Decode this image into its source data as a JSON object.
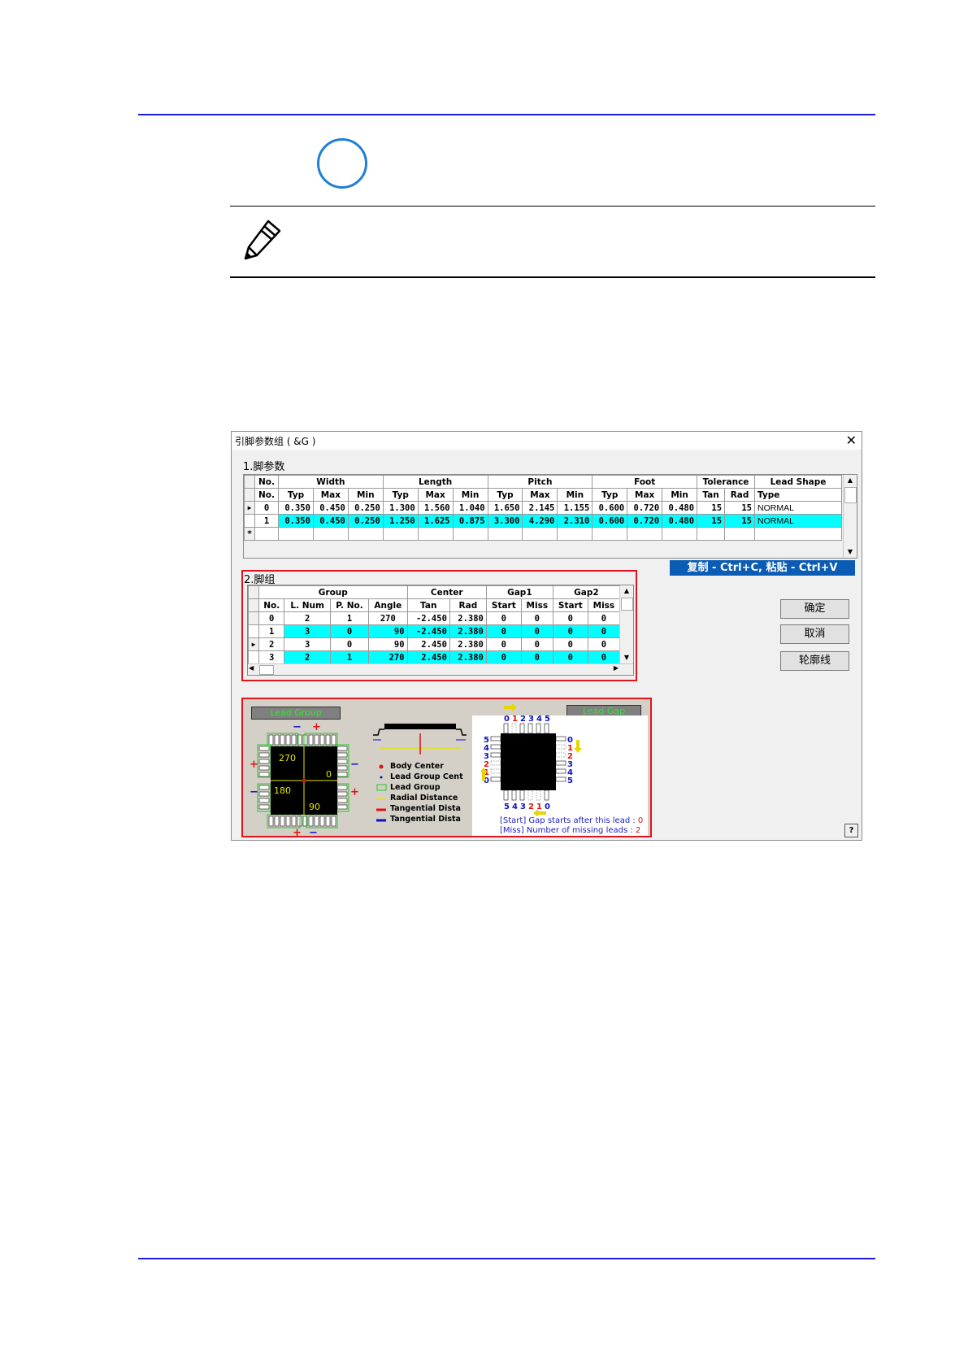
{
  "dialog": {
    "title": "引脚参数组 ( &G )",
    "close": "✕",
    "section1": "1.脚参数",
    "section2": "2.脚组",
    "copy_hint": "复制 - Ctrl+C, 粘贴 - Ctrl+V",
    "buttons": {
      "ok": "确定",
      "cancel": "取消",
      "outline": "轮廓线"
    },
    "help": "?"
  },
  "lead_params": {
    "group_headers": [
      "No.",
      "Width",
      "Length",
      "Pitch",
      "Foot",
      "Tolerance",
      "Lead Shape"
    ],
    "sub_headers": [
      "No.",
      "Typ",
      "Max",
      "Min",
      "Typ",
      "Max",
      "Min",
      "Typ",
      "Max",
      "Min",
      "Typ",
      "Max",
      "Min",
      "Tan",
      "Rad",
      "Type"
    ],
    "rows": [
      [
        "0",
        "0.350",
        "0.450",
        "0.250",
        "1.300",
        "1.560",
        "1.040",
        "1.650",
        "2.145",
        "1.155",
        "0.600",
        "0.720",
        "0.480",
        "15",
        "15",
        "NORMAL"
      ],
      [
        "1",
        "0.350",
        "0.450",
        "0.250",
        "1.250",
        "1.625",
        "0.875",
        "3.300",
        "4.290",
        "2.310",
        "0.600",
        "0.720",
        "0.480",
        "15",
        "15",
        "NORMAL"
      ]
    ],
    "new_row_marker": "*",
    "current_marker": "▶"
  },
  "lead_groups": {
    "group_headers": [
      "Group",
      "Center",
      "Gap1",
      "Gap2"
    ],
    "sub_headers": [
      "No.",
      "L. Num",
      "P. No.",
      "Angle",
      "Tan",
      "Rad",
      "Start",
      "Miss",
      "Start",
      "Miss"
    ],
    "rows": [
      [
        "0",
        "2",
        "1",
        "270",
        "-2.450",
        "2.380",
        "0",
        "0",
        "0",
        "0"
      ],
      [
        "1",
        "3",
        "0",
        "90",
        "-2.450",
        "2.380",
        "0",
        "0",
        "0",
        "0"
      ],
      [
        "2",
        "3",
        "0",
        "90",
        "2.450",
        "2.380",
        "0",
        "0",
        "0",
        "0"
      ],
      [
        "3",
        "2",
        "1",
        "270",
        "2.450",
        "2.380",
        "0",
        "0",
        "0",
        "0"
      ]
    ],
    "current_marker": "▶"
  },
  "diagram": {
    "lead_group_label": "Lead Group",
    "lead_gap_label": "Lead Gap",
    "angles": [
      "270",
      "0",
      "180",
      "90"
    ],
    "signs": {
      "plus": "+",
      "minus": "−"
    },
    "legend": [
      "Body Center",
      "Lead Group Cent",
      "Lead Group",
      "Radial Distance",
      "Tangential Dista",
      "Tangential Dista"
    ],
    "gap_top_numbers": [
      "0",
      "1",
      "2",
      "3",
      "4",
      "5"
    ],
    "gap_right_numbers": [
      "0",
      "1",
      "2",
      "3",
      "4",
      "5"
    ],
    "gap_left_numbers": [
      "5",
      "4",
      "3",
      "2",
      "1",
      "0"
    ],
    "gap_bottom_numbers": [
      "5",
      "4",
      "3",
      "2",
      "1",
      "0"
    ],
    "start_note_tag": "[Start]",
    "start_note_text": "Gap starts after this lead : ",
    "start_note_value": "0",
    "miss_note_tag": "[Miss]",
    "miss_note_text": "Number of missing leads : ",
    "miss_note_value": "2"
  },
  "colors": {
    "rule_blue": "#1e1edc",
    "circle_blue": "#1f7fd6",
    "selected_row": "#00ffff",
    "copy_bar": "#0a5cb4",
    "highlight_border": "#e0141e"
  }
}
